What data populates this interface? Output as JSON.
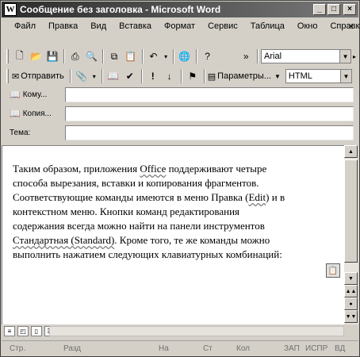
{
  "window": {
    "title": "Сообщение без заголовка - Microsoft Word",
    "app_icon": "W"
  },
  "caption_buttons": {
    "minimize": "_",
    "maximize": "□",
    "close": "×"
  },
  "menu": {
    "items": [
      "Файл",
      "Правка",
      "Вид",
      "Вставка",
      "Формат",
      "Сервис",
      "Таблица",
      "Окно",
      "Справка"
    ],
    "close_doc": "×"
  },
  "standard_toolbar": {
    "icons": [
      "new-icon",
      "open-icon",
      "save-icon",
      "print-icon",
      "print-preview-icon",
      "copy-icon",
      "paste-icon",
      "undo-icon",
      "hyperlink-icon",
      "help-icon"
    ],
    "font": "Arial",
    "more": "»"
  },
  "email_toolbar": {
    "send_label": "Отправить",
    "options_label": "Параметры...",
    "format": "HTML"
  },
  "fields": {
    "to_label": "Кому...",
    "cc_label": "Копия...",
    "subject_label": "Тема:",
    "to_value": "",
    "cc_value": "",
    "subject_value": ""
  },
  "document": {
    "lines": [
      [
        "Таким образом, приложения ",
        "Office",
        " поддерживают четыре"
      ],
      [
        "способа вырезания, вставки и копирования фрагментов.",
        "",
        ""
      ],
      [
        "Соответствующие команды имеются в меню Правка (",
        "Edit",
        ") и в"
      ],
      [
        "контекстном меню. Кнопки команд редактирования",
        "",
        ""
      ],
      [
        "содержания всегда можно найти на панели инструментов",
        "",
        ""
      ],
      [
        "",
        "Стандартная (Standard)",
        ". Кроме того, те же команды можно"
      ],
      [
        "выполнить нажатием следующих клавиатурных комбинаций:",
        "",
        ""
      ]
    ]
  },
  "statusbar": {
    "page": "Стр.",
    "section": "Разд",
    "at": "На",
    "line": "Ст",
    "col": "Кол",
    "rec": "ЗАП",
    "trk": "ИСПР",
    "ext": "ВД"
  }
}
